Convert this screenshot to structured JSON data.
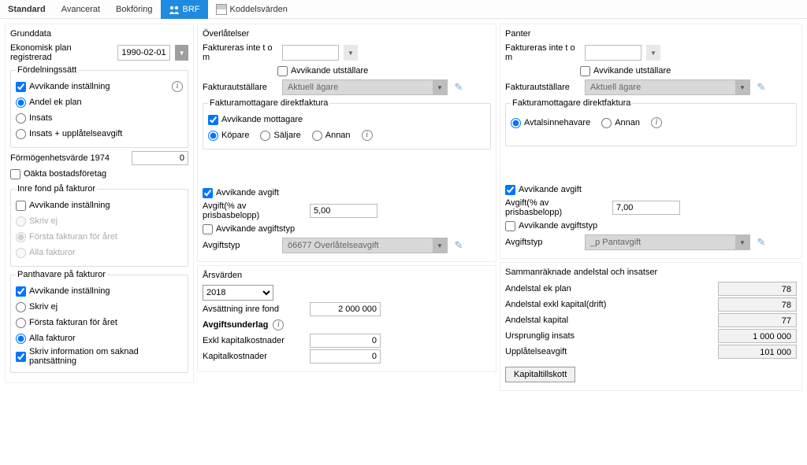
{
  "tabs": {
    "standard": "Standard",
    "avancerat": "Avancerat",
    "bokforing": "Bokföring",
    "brf": "BRF",
    "koddel": "Koddelsvärden"
  },
  "col1": {
    "grunddata": {
      "title": "Grunddata",
      "plan_label": "Ekonomisk plan registrerad",
      "plan_date": "1990-02-01"
    },
    "fordel": {
      "legend": "Fördelningssätt",
      "avvik": "Avvikande inställning",
      "andel": "Andel ek plan",
      "insats": "Insats",
      "insats_uppl": "Insats + upplåtelseavgift"
    },
    "formogen": {
      "label": "Förmögenhetsvärde 1974",
      "value": "0"
    },
    "oakta": "Oäkta bostadsföretag",
    "inrefond": {
      "legend": "Inre fond på fakturor",
      "avvik": "Avvikande inställning",
      "skrivej": "Skriv ej",
      "forsta": "Första fakturan för året",
      "alla": "Alla fakturor"
    },
    "panth": {
      "legend": "Panthavare på fakturor",
      "avvik": "Avvikande inställning",
      "skrivej": "Skriv ej",
      "forsta": "Första fakturan för året",
      "alla": "Alla fakturor",
      "saknad": "Skriv information om saknad pantsättning"
    }
  },
  "col2": {
    "overlat": {
      "title": "Överlåtelser",
      "fakt_inte": "Faktureras inte t o m",
      "avvik_utst": "Avvikande utställare",
      "fakt_utst": "Fakturautställare",
      "fakt_utst_val": "Aktuell ägare",
      "fm_legend": "Fakturamottagare direktfaktura",
      "avvik_mott": "Avvikande mottagare",
      "kopare": "Köpare",
      "saljare": "Säljare",
      "annan": "Annan",
      "avvik_avg": "Avvikande avgift",
      "avgift_pb": "Avgift(% av prisbasbelopp)",
      "avgift_val": "5,00",
      "avvik_typ": "Avvikande avgiftstyp",
      "avgtyp_label": "Avgiftstyp",
      "avgtyp_val": "ö6677  Överlåtelseavgift"
    },
    "arsv": {
      "title": "Årsvärden",
      "year": "2018",
      "avs_inre": "Avsättning inre fond",
      "avs_inre_val": "2 000 000",
      "underlag": "Avgiftsunderlag",
      "exkl_kap": "Exkl kapitalkostnader",
      "exkl_kap_val": "0",
      "kap": "Kapitalkostnader",
      "kap_val": "0"
    }
  },
  "col3": {
    "panter": {
      "title": "Panter",
      "fakt_inte": "Faktureras inte t o m",
      "avvik_utst": "Avvikande utställare",
      "fakt_utst": "Fakturautställare",
      "fakt_utst_val": "Aktuell ägare",
      "fm_legend": "Fakturamottagare direktfaktura",
      "avtals": "Avtalsinnehavare",
      "annan": "Annan",
      "avvik_avg": "Avvikande avgift",
      "avgift_pb": "Avgift(% av prisbasbelopp)",
      "avgift_val": "7,00",
      "avvik_typ": "Avvikande avgiftstyp",
      "avgtyp_label": "Avgiftstyp",
      "avgtyp_val": "_p    Pantavgift"
    },
    "samman": {
      "title": "Sammanräknade andelstal och insatser",
      "ek_plan": "Andelstal ek plan",
      "ek_plan_v": "78",
      "exkl_drift": "Andelstal exkl kapital(drift)",
      "exkl_drift_v": "78",
      "kapital": "Andelstal kapital",
      "kapital_v": "77",
      "urspr": "Ursprunglig insats",
      "urspr_v": "1 000 000",
      "uppl": "Upplåtelseavgift",
      "uppl_v": "101 000",
      "btn": "Kapitaltillskott"
    }
  }
}
